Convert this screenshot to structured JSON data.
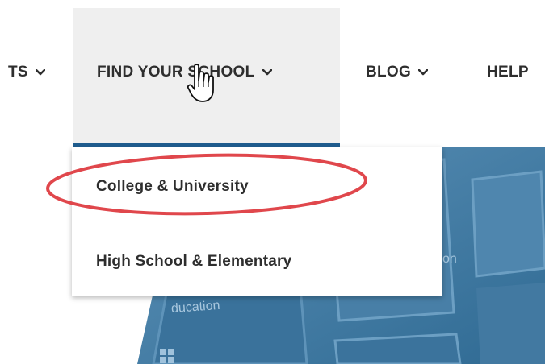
{
  "nav": {
    "items": [
      {
        "label": "TS",
        "has_chevron": true
      },
      {
        "label": "FIND YOUR SCHOOL",
        "has_chevron": true,
        "active": true
      },
      {
        "label": "BLOG",
        "has_chevron": true
      },
      {
        "label": "HELP",
        "has_chevron": false
      }
    ]
  },
  "dropdown": {
    "items": [
      {
        "label": "College & University",
        "highlighted": true
      },
      {
        "label": "High School & Elementary"
      }
    ]
  },
  "background": {
    "fragments": [
      "ducation",
      "on"
    ]
  },
  "colors": {
    "accent": "#1f5d8f",
    "highlight": "#e0474c",
    "active_bg": "#efefef",
    "text": "#2e2e2e",
    "image_blue": "#3f7aa2"
  },
  "icons": {
    "chevron": "chevron-down-icon",
    "cursor": "hand-pointer-cursor-icon",
    "windows": "windows-logo-icon"
  }
}
